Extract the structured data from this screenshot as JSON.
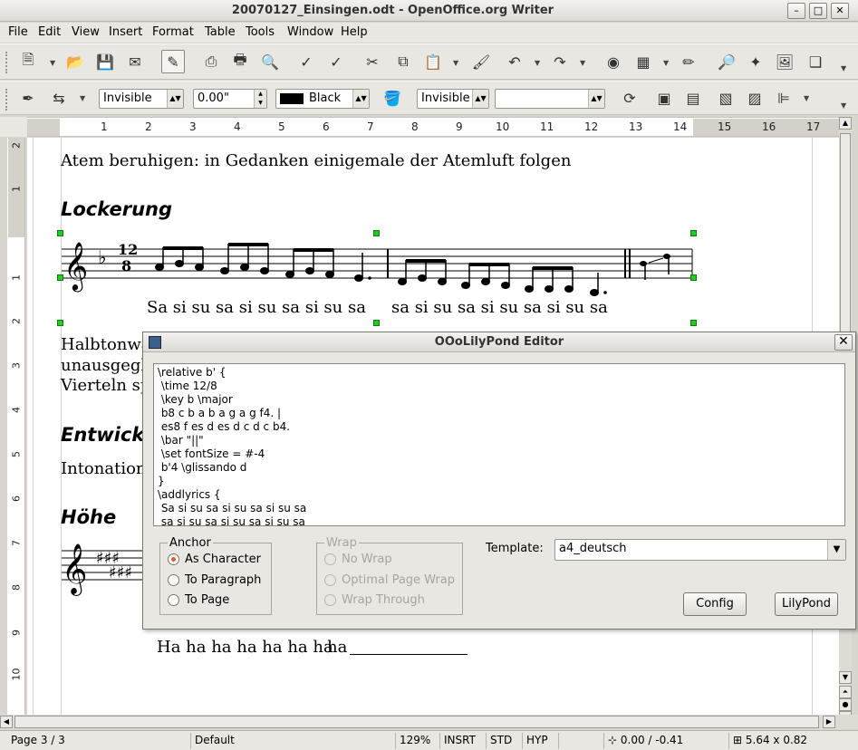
{
  "window": {
    "title": "20070127_Einsingen.odt - OpenOffice.org Writer",
    "min": "–",
    "max": "□",
    "close": "✕"
  },
  "menu": [
    "File",
    "Edit",
    "View",
    "Insert",
    "Format",
    "Table",
    "Tools",
    "Window",
    "Help"
  ],
  "format_toolbar": {
    "line_style": "Invisible",
    "line_width": "0.00\"",
    "line_color": "Black",
    "area_style": "Invisible",
    "area_fill": ""
  },
  "ruler": {
    "h_labels": [
      "1",
      "2",
      "3",
      "4",
      "5",
      "6",
      "7",
      "8",
      "9",
      "10",
      "11",
      "12",
      "13",
      "14",
      "15",
      "16",
      "17"
    ],
    "v_labels": [
      "2",
      "1",
      "1",
      "2",
      "3",
      "4",
      "5",
      "6",
      "7",
      "8",
      "9",
      "10"
    ]
  },
  "document": {
    "line1": "Atem beruhigen: in Gedanken einigemale der Atemluft folgen",
    "heading1": "Lockerung",
    "lyrics1a": "Sa si su sa si su sa si su sa",
    "lyrics1b": "sa si su sa si su sa si su sa",
    "time_sig_top": "12",
    "time_sig_bottom": "8",
    "para1": "Halbtonwä",
    "para2": "unausgegli",
    "para3": "Vierteln sp",
    "heading2": "Entwick",
    "para4": "Intonations",
    "heading3": "Höhe",
    "lyrics2a": "Ha ha ha ha ha ha ha",
    "lyrics2b": "ha"
  },
  "dialog": {
    "title": "OOoLilyPond Editor",
    "code": "\\relative b' {\n \\time 12/8\n \\key b \\major\n b8 c b a b a g a g f4. |\n es8 f es d es d c d c b4.\n \\bar \"||\"\n \\set fontSize = #-4\n b'4 \\glissando d\n}\n\\addlyrics {\n Sa si su sa si su sa si su sa\n sa si su sa si su sa si su sa",
    "anchor_label": "Anchor",
    "anchor_options": [
      "As Character",
      "To Paragraph",
      "To Page"
    ],
    "wrap_label": "Wrap",
    "wrap_options": [
      "No Wrap",
      "Optimal Page Wrap",
      "Wrap Through"
    ],
    "template_label": "Template:",
    "template_value": "a4_deutsch",
    "config_button": "Config",
    "lilypond_button": "LilyPond"
  },
  "status": {
    "page": "Page 3 / 3",
    "style": "Default",
    "zoom": "129%",
    "insert_mode": "INSRT",
    "selection_mode": "STD",
    "hyperlink_mode": "HYP",
    "position": "0.00 / -0.41",
    "size": "5.64 x 0.82"
  }
}
